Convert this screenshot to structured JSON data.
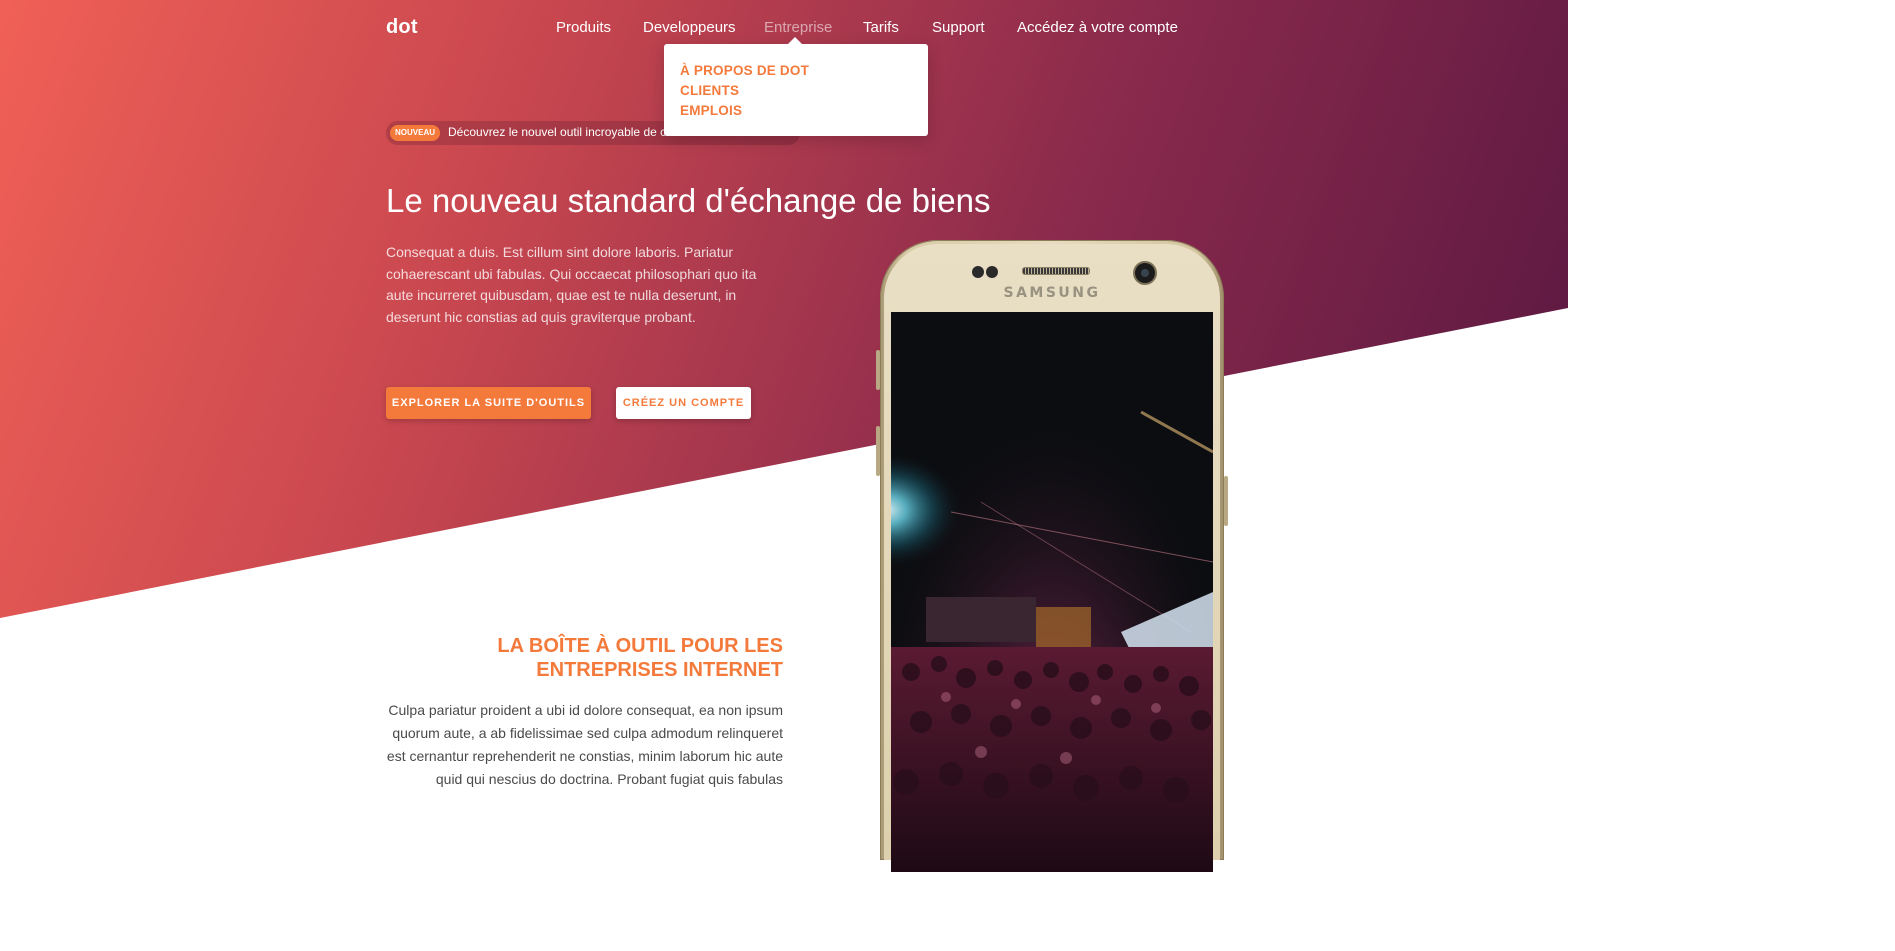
{
  "brand": {
    "logo": "dot"
  },
  "nav": {
    "items": [
      {
        "label": "Produits"
      },
      {
        "label": "Developpeurs"
      },
      {
        "label": "Entreprise"
      },
      {
        "label": "Tarifs"
      },
      {
        "label": "Support"
      },
      {
        "label": "Accédez à votre compte"
      }
    ],
    "active": "Entreprise"
  },
  "dropdown": {
    "items": [
      {
        "label": "À propos de dot"
      },
      {
        "label": "Clients"
      },
      {
        "label": "Emplois"
      }
    ]
  },
  "announcement": {
    "badge": "Nouveau",
    "text": "Découvrez le nouvel outil incroyable de c"
  },
  "hero": {
    "title": "Le nouveau standard d'échange de biens",
    "lead": "Consequat a duis. Est cillum sint dolore laboris. Pariatur cohaerescant ubi fabulas. Qui occaecat philosophari quo ita aute incurreret quibusdam, quae est te nulla deserunt, in deserunt hic constias ad quis graviterque probant.",
    "primary_button": "Explorer la suite d'outils",
    "secondary_button": "Créez un compte"
  },
  "phone": {
    "brand_text": "SAMSUNG",
    "screen_content": "concert-crowd-photo"
  },
  "feature": {
    "title": "La boîte à outil pour les entreprises internet",
    "body": "Culpa pariatur proident a ubi id dolore consequat, ea non ipsum quorum aute, a ab fidelissimae sed culpa admodum relinqueret est cernantur reprehenderit ne constias, minim laborum hic aute quid qui nescius do doctrina. Probant fugiat quis fabulas"
  },
  "colors": {
    "accent": "#f47a3c",
    "gradient_start": "#f06056",
    "gradient_end": "#531540"
  }
}
